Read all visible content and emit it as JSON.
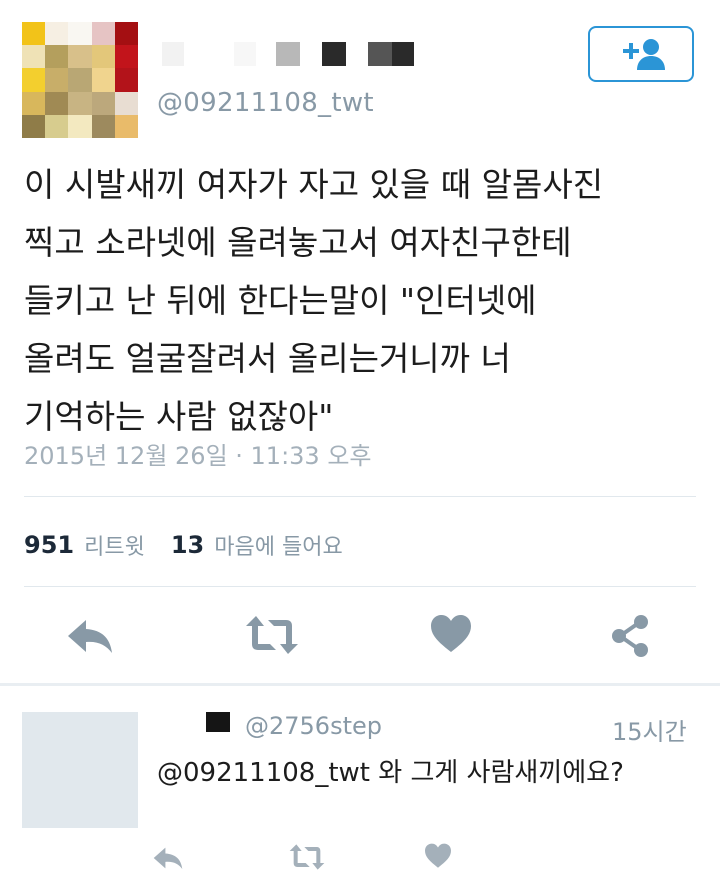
{
  "tweet": {
    "handle": "@09211108_twt",
    "follow_icon": "follow-user-icon",
    "text_lines": [
      "이 시발새끼 여자가 자고 있을 때 알몸사진",
      "찍고 소라넷에 올려놓고서 여자친구한테",
      "들키고 난 뒤에 한다는말이 \"인터넷에",
      "올려도 얼굴잘려서 올리는거니까 너",
      "기억하는 사람 없잖아\""
    ],
    "timestamp": "2015년 12월 26일 · 11:33 오후",
    "retweets": {
      "count": "951",
      "label": "리트윗"
    },
    "likes": {
      "count": "13",
      "label": "마음에 들어요"
    },
    "actions": [
      "reply-icon",
      "retweet-icon",
      "heart-icon",
      "share-icon"
    ]
  },
  "reply": {
    "handle": "@2756step",
    "time": "15시간",
    "text": "@09211108_twt 와 그게 사람새끼에요?",
    "actions": [
      "reply-icon",
      "retweet-icon",
      "heart-icon"
    ]
  },
  "colors": {
    "accent": "#2b95d6",
    "icon_gray": "#8899a6",
    "muted_text": "#a4b0ba",
    "divider": "#e1e8ed"
  }
}
